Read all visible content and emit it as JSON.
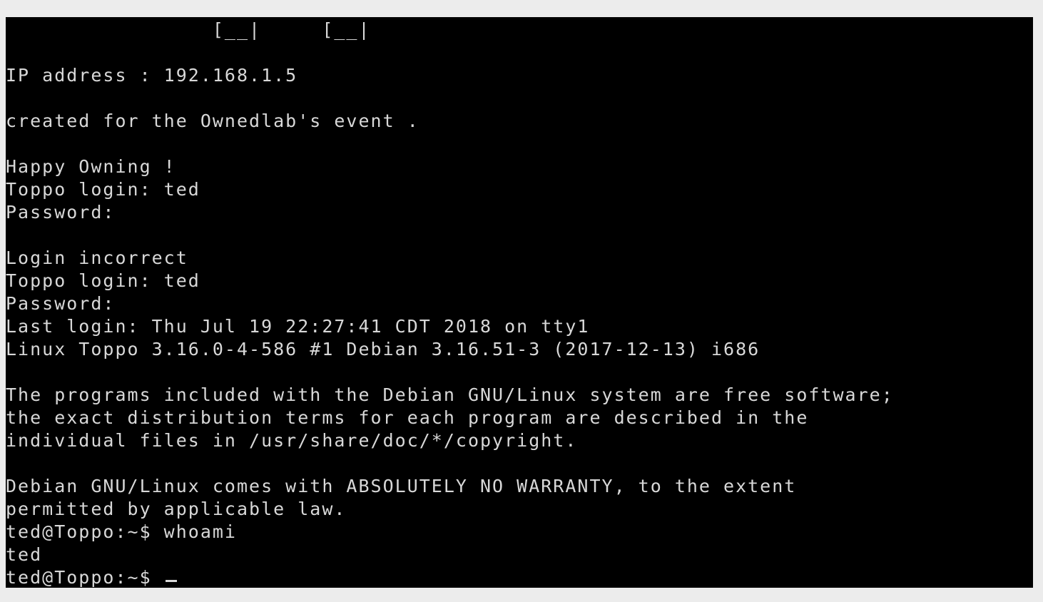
{
  "terminal": {
    "lines": [
      "                 [__|     [__|",
      "",
      "IP address : 192.168.1.5",
      "",
      "created for the Ownedlab's event .",
      "",
      "Happy Owning !",
      "Toppo login: ted",
      "Password:",
      "",
      "Login incorrect",
      "Toppo login: ted",
      "Password:",
      "Last login: Thu Jul 19 22:27:41 CDT 2018 on tty1",
      "Linux Toppo 3.16.0-4-586 #1 Debian 3.16.51-3 (2017-12-13) i686",
      "",
      "The programs included with the Debian GNU/Linux system are free software;",
      "the exact distribution terms for each program are described in the",
      "individual files in /usr/share/doc/*/copyright.",
      "",
      "Debian GNU/Linux comes with ABSOLUTELY NO WARRANTY, to the extent",
      "permitted by applicable law.",
      "ted@Toppo:~$ whoami",
      "ted"
    ],
    "prompt": "ted@Toppo:~$ "
  },
  "colors": {
    "background": "#000000",
    "text": "#d8d8d8",
    "page": "#ececec"
  }
}
